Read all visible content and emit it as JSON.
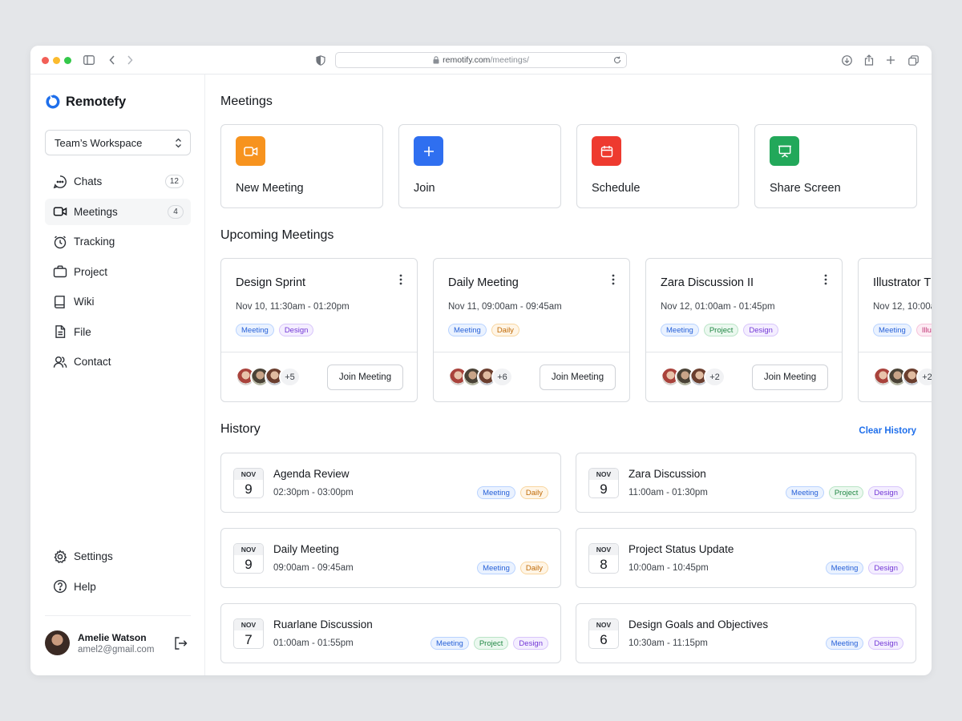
{
  "browser": {
    "url_domain": "remotify.com",
    "url_path": "/meetings/"
  },
  "app": {
    "name": "Remotefy"
  },
  "workspace": {
    "label": "Team’s Workspace"
  },
  "sidebar": {
    "items": [
      {
        "label": "Chats",
        "count": "12",
        "icon": "chat-icon"
      },
      {
        "label": "Meetings",
        "count": "4",
        "icon": "video-icon",
        "active": true
      },
      {
        "label": "Tracking",
        "icon": "timer-icon"
      },
      {
        "label": "Project",
        "icon": "briefcase-icon"
      },
      {
        "label": "Wiki",
        "icon": "book-icon"
      },
      {
        "label": "File",
        "icon": "file-icon"
      },
      {
        "label": "Contact",
        "icon": "users-icon"
      }
    ],
    "bottom": [
      {
        "label": "Settings",
        "icon": "gear-icon"
      },
      {
        "label": "Help",
        "icon": "help-icon"
      }
    ]
  },
  "user": {
    "name": "Amelie Watson",
    "email": "amel2@gmail.com"
  },
  "main": {
    "meetings_title": "Meetings",
    "quick_actions": [
      {
        "label": "New Meeting",
        "color": "#f7931e",
        "icon": "video-icon"
      },
      {
        "label": "Join",
        "color": "#2f6ff0",
        "icon": "plus-icon"
      },
      {
        "label": "Schedule",
        "color": "#ee3a2f",
        "icon": "calendar-icon"
      },
      {
        "label": "Share Screen",
        "color": "#22a85a",
        "icon": "presentation-icon"
      }
    ],
    "upcoming_title": "Upcoming Meetings",
    "upcoming": [
      {
        "title": "Design Sprint",
        "time": "Nov 10, 11:30am - 01:20pm",
        "tags": [
          "Meeting",
          "Design"
        ],
        "more": "+5",
        "button": "Join Meeting"
      },
      {
        "title": "Daily Meeting",
        "time": "Nov 11, 09:00am - 09:45am",
        "tags": [
          "Meeting",
          "Daily"
        ],
        "more": "+6",
        "button": "Join Meeting"
      },
      {
        "title": "Zara Discussion II",
        "time": "Nov 12, 01:00am - 01:45pm",
        "tags": [
          "Meeting",
          "Project",
          "Design"
        ],
        "more": "+2",
        "button": "Join Meeting"
      },
      {
        "title": "Illustrator T",
        "time": "Nov 12, 10:00a",
        "tags": [
          "Meeting",
          "Illu"
        ],
        "more": "+2",
        "button": ""
      }
    ],
    "history_title": "History",
    "clear_history": "Clear History",
    "history": [
      {
        "month": "NOV",
        "day": "9",
        "title": "Agenda Review",
        "time": "02:30pm - 03:00pm",
        "tags": [
          "Meeting",
          "Daily"
        ]
      },
      {
        "month": "NOV",
        "day": "9",
        "title": "Zara Discussion",
        "time": "11:00am - 01:30pm",
        "tags": [
          "Meeting",
          "Project",
          "Design"
        ]
      },
      {
        "month": "NOV",
        "day": "9",
        "title": "Daily Meeting",
        "time": "09:00am - 09:45am",
        "tags": [
          "Meeting",
          "Daily"
        ]
      },
      {
        "month": "NOV",
        "day": "8",
        "title": "Project Status Update",
        "time": "10:00am - 10:45pm",
        "tags": [
          "Meeting",
          "Design"
        ]
      },
      {
        "month": "NOV",
        "day": "7",
        "title": "Ruarlane Discussion",
        "time": "01:00am - 01:55pm",
        "tags": [
          "Meeting",
          "Project",
          "Design"
        ]
      },
      {
        "month": "NOV",
        "day": "6",
        "title": "Design Goals and Objectives",
        "time": "10:30am - 11:15pm",
        "tags": [
          "Meeting",
          "Design"
        ]
      }
    ]
  }
}
